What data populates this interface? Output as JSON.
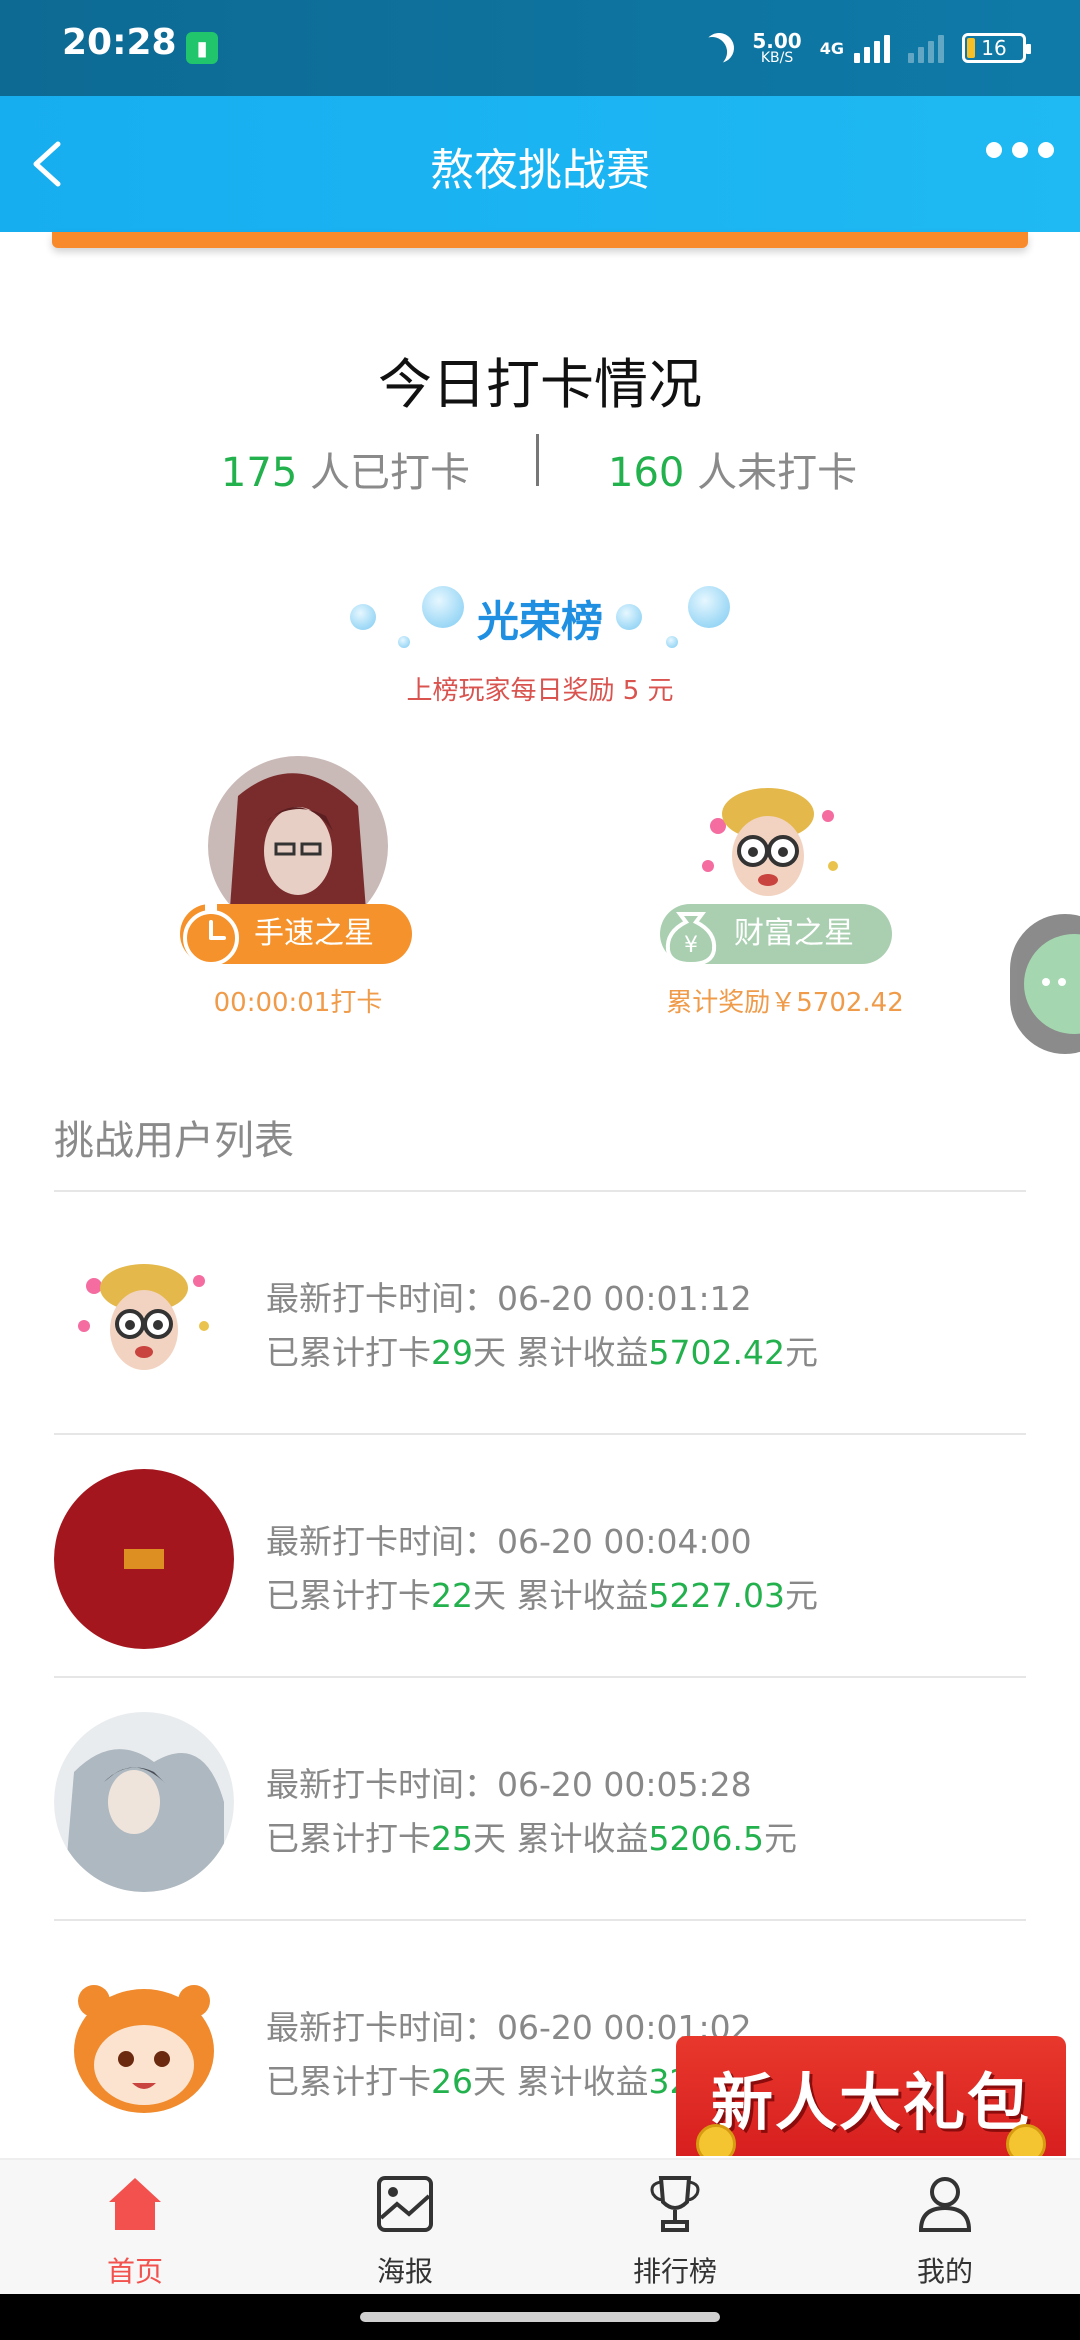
{
  "status_bar": {
    "time": "20:28",
    "speed": "5.00",
    "speed_unit": "KB/S",
    "network": "4G",
    "battery": "16"
  },
  "header": {
    "title": "熬夜挑战赛"
  },
  "today": {
    "title": "今日打卡情况",
    "checked_count": "175",
    "checked_label": " 人已打卡",
    "unchecked_count": "160",
    "unchecked_label": " 人未打卡"
  },
  "honor": {
    "title": "光荣榜",
    "subtitle": "上榜玩家每日奖励 5 元",
    "stars": [
      {
        "badge": "手速之星",
        "caption": "00:00:01打卡"
      },
      {
        "badge": "财富之星",
        "caption": "累计奖励￥5702.42"
      }
    ]
  },
  "list": {
    "title": "挑战用户列表",
    "time_label": "最新打卡时间：",
    "days_prefix": "已累计打卡",
    "days_suffix": "天",
    "earn_prefix": " 累计收益",
    "earn_suffix": "元",
    "rows": [
      {
        "time": "06-20 00:01:12",
        "days": "29",
        "earnings": "5702.42"
      },
      {
        "time": "06-20 00:04:00",
        "days": "22",
        "earnings": "5227.03"
      },
      {
        "time": "06-20 00:05:28",
        "days": "25",
        "earnings": "5206.5"
      },
      {
        "time": "06-20 00:01:02",
        "days": "26",
        "earnings": "32"
      }
    ]
  },
  "promo": {
    "text": "新人大礼包"
  },
  "bottom_nav": [
    {
      "label": "首页",
      "icon": "home-icon",
      "active": true
    },
    {
      "label": "海报",
      "icon": "poster-icon",
      "active": false
    },
    {
      "label": "排行榜",
      "icon": "trophy-icon",
      "active": false
    },
    {
      "label": "我的",
      "icon": "user-icon",
      "active": false
    }
  ],
  "colors": {
    "header": "#17aef0",
    "accent_green": "#22b14c",
    "orange": "#f5922b",
    "red": "#f2514d"
  }
}
